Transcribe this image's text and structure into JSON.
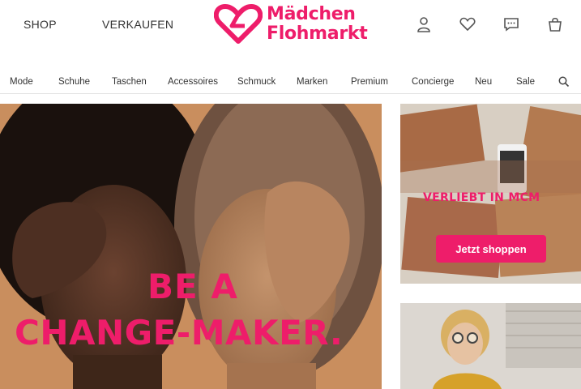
{
  "header": {
    "nav": [
      "SHOP",
      "VERKAUFEN"
    ],
    "logo": {
      "line1": "Mädchen",
      "line2": "Flohmarkt",
      "color": "#ee1d6a"
    },
    "icons": [
      "user-icon",
      "heart-icon",
      "chat-icon",
      "bag-icon"
    ]
  },
  "categories": [
    "Mode",
    "Schuhe",
    "Taschen",
    "Accessoires",
    "Schmuck",
    "Marken",
    "Premium",
    "Concierge",
    "Neu",
    "Sale"
  ],
  "hero": {
    "line1": "BE A",
    "line2": "CHANGE-MAKER."
  },
  "promo1": {
    "title": "VERLIEBT IN MCM",
    "button": "Jetzt shoppen"
  },
  "colors": {
    "accent": "#ee1d6a"
  }
}
